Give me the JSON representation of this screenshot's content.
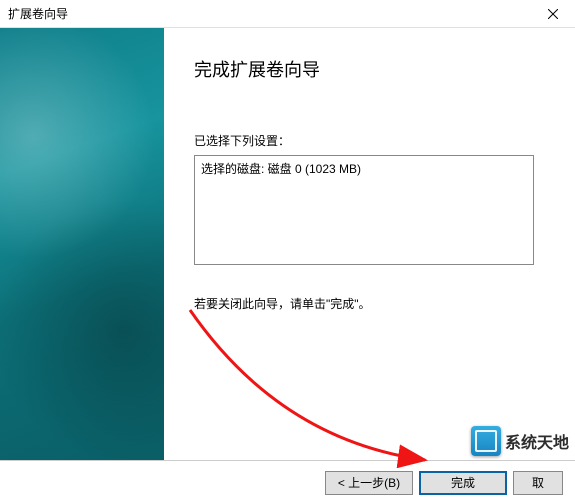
{
  "window": {
    "title": "扩展卷向导"
  },
  "main": {
    "heading": "完成扩展卷向导",
    "settings_label": "已选择下列设置：",
    "settings_content": "选择的磁盘: 磁盘 0 (1023 MB)",
    "instruction": "若要关闭此向导，请单击\"完成\"。"
  },
  "footer": {
    "back": "< 上一步(B)",
    "finish": "完成",
    "cancel_partial": "取"
  },
  "watermark": {
    "text": "系统天地"
  }
}
